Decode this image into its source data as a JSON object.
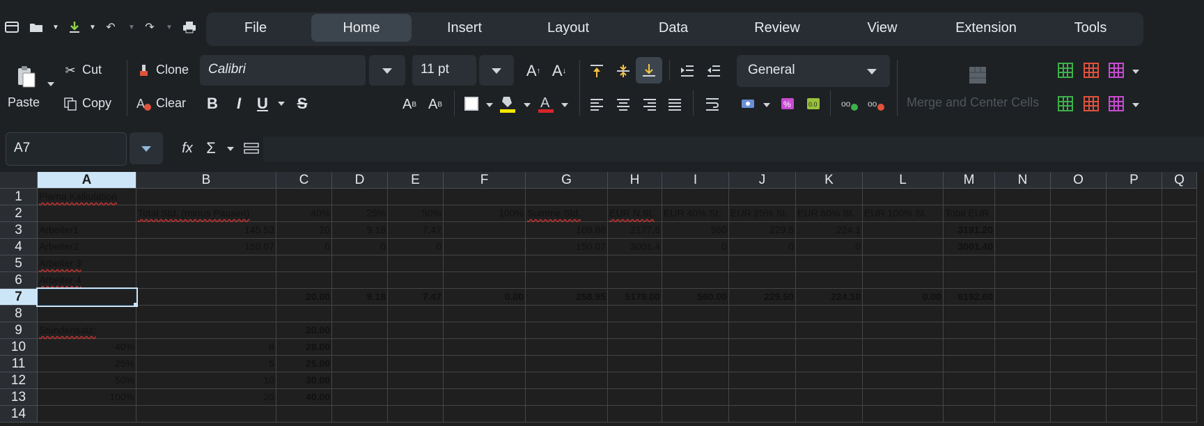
{
  "quick_access": {
    "icons": [
      "menu-icon",
      "open-folder-icon",
      "save-icon",
      "undo-icon",
      "redo-icon",
      "print-icon"
    ]
  },
  "menu": {
    "tabs": [
      "File",
      "Home",
      "Insert",
      "Layout",
      "Data",
      "Review",
      "View",
      "Extension",
      "Tools"
    ],
    "active": "Home"
  },
  "ribbon": {
    "paste": "Paste",
    "cut": "Cut",
    "copy": "Copy",
    "clone": "Clone",
    "clear": "Clear",
    "font_name": "Calibri",
    "font_size": "11 pt",
    "number_format": "General",
    "merge": "Merge and Center Cells"
  },
  "formula_bar": {
    "cell_ref": "A7",
    "content": ""
  },
  "sheet": {
    "columns": [
      "A",
      "B",
      "C",
      "D",
      "E",
      "F",
      "G",
      "H",
      "I",
      "J",
      "K",
      "L",
      "M",
      "N",
      "O",
      "P",
      "Q"
    ],
    "rows": [
      "1",
      "2",
      "3",
      "4",
      "5",
      "6",
      "7",
      "8",
      "9",
      "10",
      "11",
      "12",
      "13",
      "14"
    ],
    "selected_cell": "A7",
    "cells": {
      "A1": "Plama Kalkulation",
      "B2": "Total Std. (minus Pausen)",
      "C2": "40%",
      "D2": "25%",
      "E2": "50%",
      "F2": "100%",
      "G2": "Summe Std.",
      "H2": "EUR N.St.",
      "I2": "EUR 40% St.",
      "J2": "EUR 25% St.",
      "K2": "EUR 50% St.",
      "L2": "EUR 100% St.",
      "M2": "Total EUR",
      "A3": "Arbeiter1",
      "B3": "145.53",
      "C3": "20",
      "D3": "9.18",
      "E3": "7.47",
      "G3": "108.88",
      "H3": "2177.6",
      "I3": "560",
      "J3": "229.5",
      "K3": "224.1",
      "M3": "3191.20",
      "A4": "Arbeiter2",
      "B4": "150.07",
      "C4": "0",
      "D4": "0",
      "E4": "0",
      "G4": "150.07",
      "H4": "3001.4",
      "I4": "0",
      "J4": "0",
      "K4": "0",
      "M4": "3001.40",
      "A5": "Arbeiter 3",
      "A6": "Arbeiter 4",
      "C7": "20.00",
      "D7": "9.18",
      "E7": "7.47",
      "F7": "0.00",
      "G7": "258.95",
      "H7": "5179.00",
      "I7": "560.00",
      "J7": "229.50",
      "K7": "224.10",
      "L7": "0.00",
      "M7": "6192.60",
      "A9": "Stundensatz:",
      "C9": "20.00",
      "A10": "40%",
      "B10": "8",
      "C10": "28.00",
      "A11": "25%",
      "B11": "5",
      "C11": "25.00",
      "A12": "50%",
      "B12": "10",
      "C12": "30.00",
      "A13": "100%",
      "B13": "20",
      "C13": "40.00"
    }
  }
}
